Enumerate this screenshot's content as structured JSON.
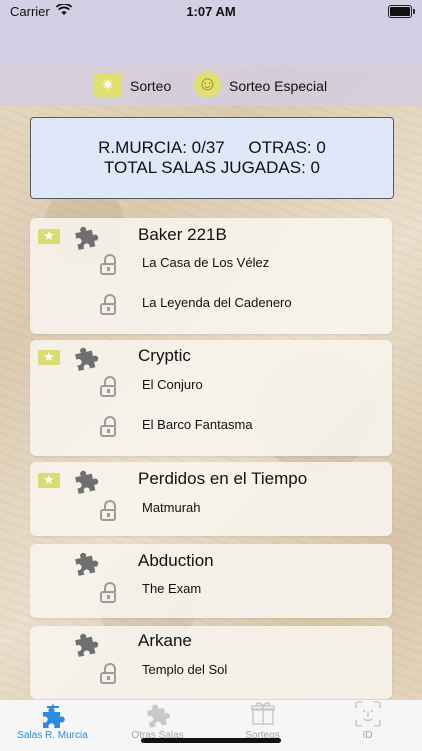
{
  "status_bar": {
    "carrier": "Carrier",
    "time": "1:07 AM"
  },
  "header": {
    "sorteo_label": "Sorteo",
    "sorteo_especial_label": "Sorteo Especial"
  },
  "summary": {
    "line1": "R.MURCIA: 0/37     OTRAS: 0",
    "line2": "TOTAL SALAS JUGADAS: 0"
  },
  "companies": [
    {
      "name": "Baker 221B",
      "starred": true,
      "rooms": [
        "La Casa de Los Vélez",
        "La Leyenda del Cadenero"
      ]
    },
    {
      "name": "Cryptic",
      "starred": true,
      "rooms": [
        "El Conjuro",
        "El Barco Fantasma"
      ]
    },
    {
      "name": "Perdidos en el Tiempo",
      "starred": true,
      "rooms": [
        "Matmurah"
      ]
    },
    {
      "name": "Abduction",
      "starred": false,
      "rooms": [
        "The Exam"
      ]
    },
    {
      "name": "Arkane",
      "starred": false,
      "rooms": [
        "Templo del Sol"
      ]
    }
  ],
  "tabbar": {
    "tabs": [
      {
        "label": "Salas R. Murcia",
        "icon": "puzzle-crown-icon",
        "active": true
      },
      {
        "label": "Otras Salas",
        "icon": "puzzle-icon",
        "active": false
      },
      {
        "label": "Sorteos",
        "icon": "gift-icon",
        "active": false
      },
      {
        "label": "ID",
        "icon": "face-id-icon",
        "active": false
      }
    ]
  },
  "colors": {
    "accent": "#2a8be0",
    "nav_bg": "#d3cfe4",
    "summary_bg": "#dfe8f8",
    "badge": "#dadb70"
  }
}
